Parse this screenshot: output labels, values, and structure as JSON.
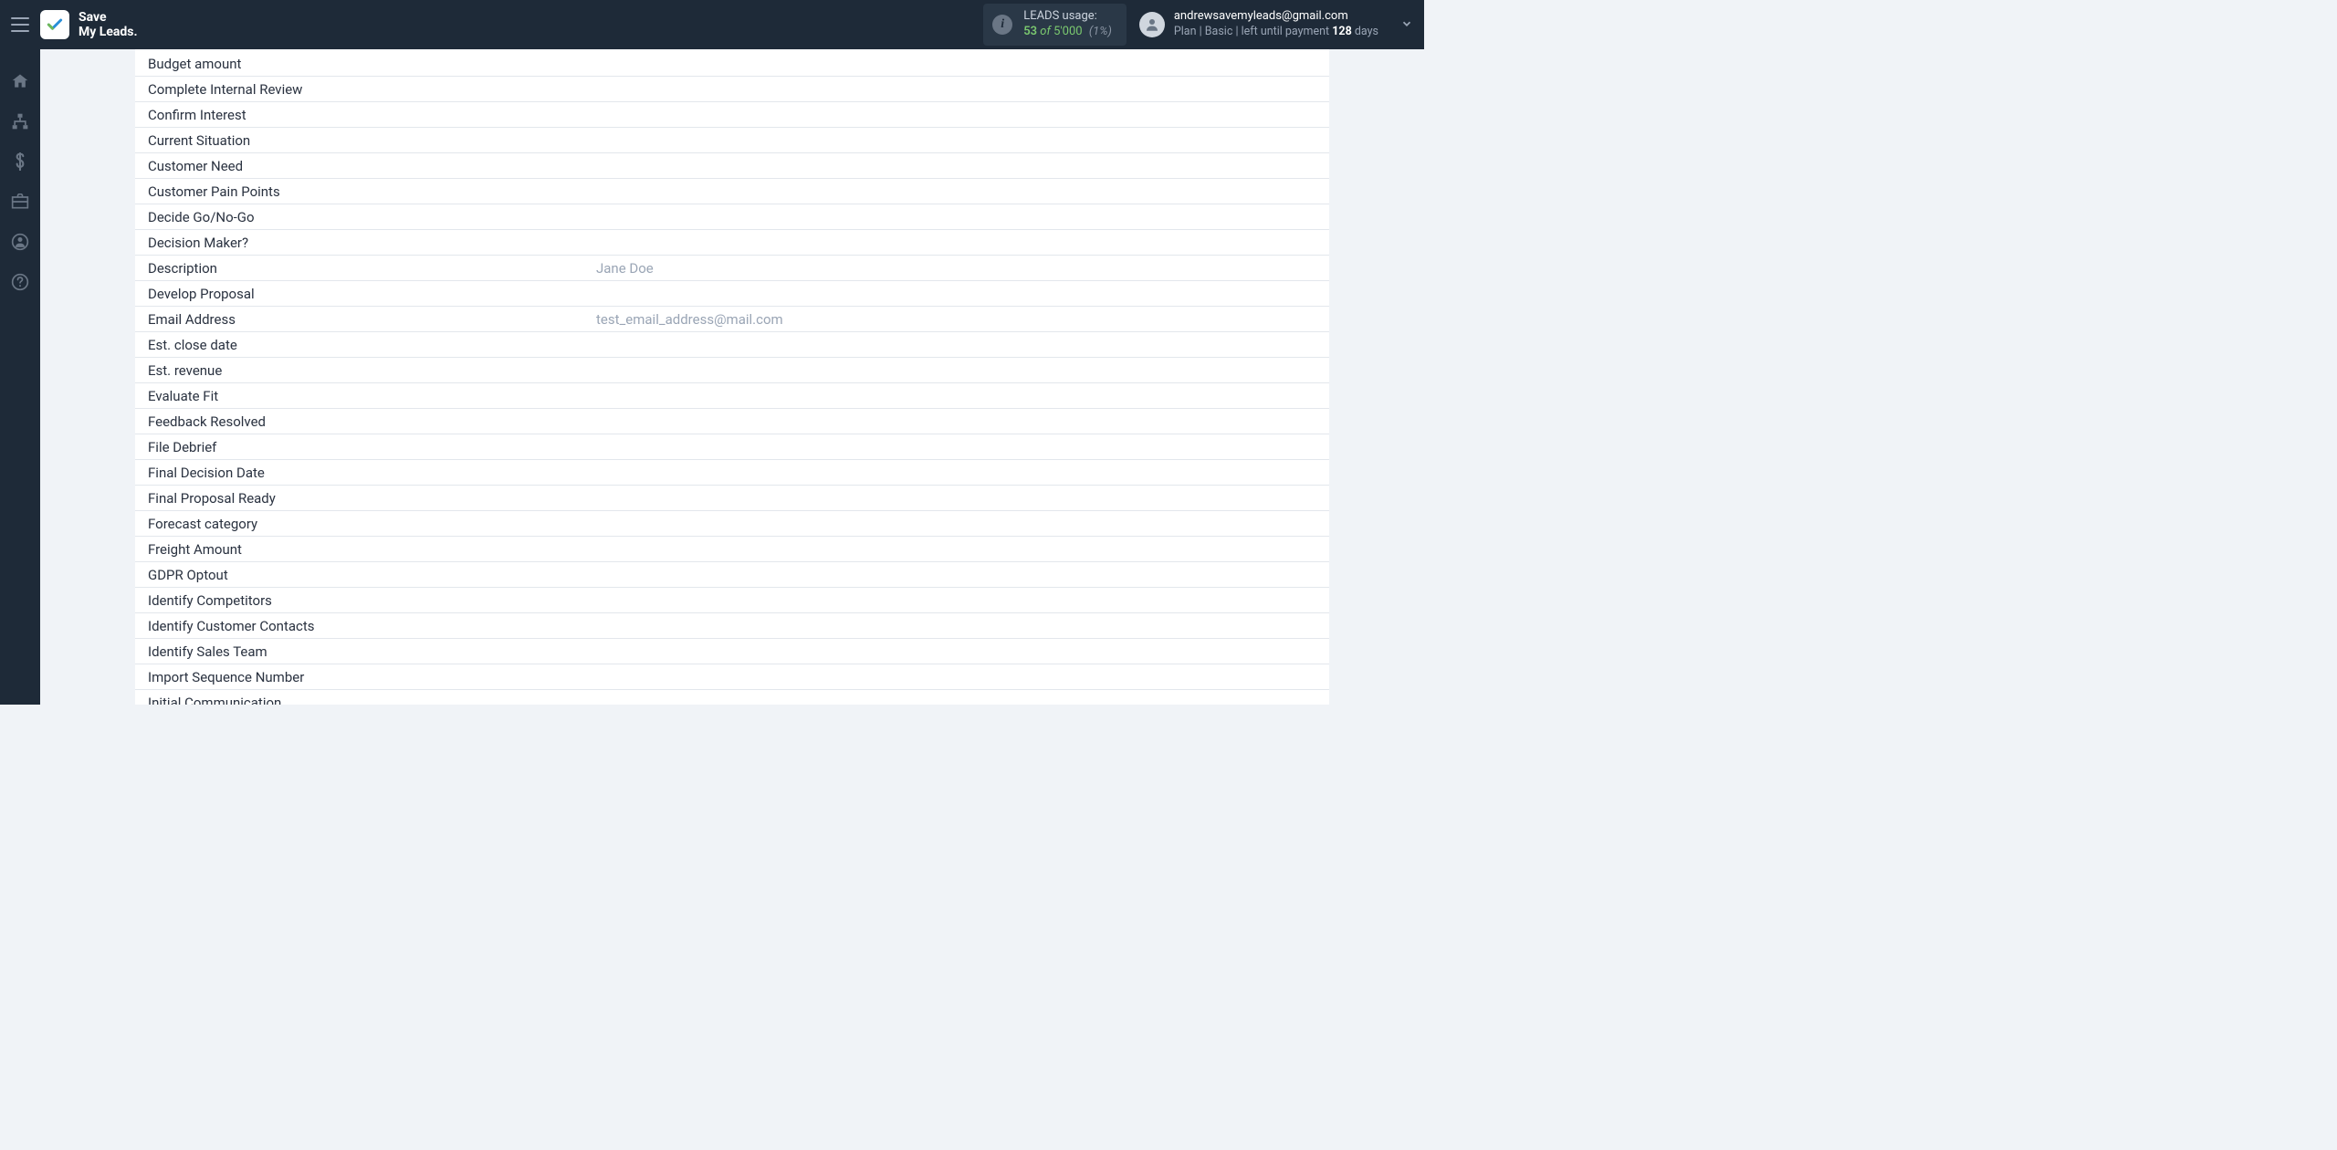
{
  "header": {
    "brand_line1": "Save",
    "brand_line2": "My Leads.",
    "usage": {
      "title": "LEADS usage:",
      "used": "53",
      "of_word": "of",
      "total": "5'000",
      "percent": "(1%)"
    },
    "user": {
      "email": "andrewsavemyleads@gmail.com",
      "plan_prefix": "Plan |",
      "plan_name": "Basic",
      "plan_mid": "| left until payment",
      "days_num": "128",
      "days_word": "days"
    }
  },
  "fields": [
    {
      "label": "Budget amount",
      "value": ""
    },
    {
      "label": "Complete Internal Review",
      "value": ""
    },
    {
      "label": "Confirm Interest",
      "value": ""
    },
    {
      "label": "Current Situation",
      "value": ""
    },
    {
      "label": "Customer Need",
      "value": ""
    },
    {
      "label": "Customer Pain Points",
      "value": ""
    },
    {
      "label": "Decide Go/No-Go",
      "value": ""
    },
    {
      "label": "Decision Maker?",
      "value": ""
    },
    {
      "label": "Description",
      "value": "Jane Doe"
    },
    {
      "label": "Develop Proposal",
      "value": ""
    },
    {
      "label": "Email Address",
      "value": "test_email_address@mail.com"
    },
    {
      "label": "Est. close date",
      "value": ""
    },
    {
      "label": "Est. revenue",
      "value": ""
    },
    {
      "label": "Evaluate Fit",
      "value": ""
    },
    {
      "label": "Feedback Resolved",
      "value": ""
    },
    {
      "label": "File Debrief",
      "value": ""
    },
    {
      "label": "Final Decision Date",
      "value": ""
    },
    {
      "label": "Final Proposal Ready",
      "value": ""
    },
    {
      "label": "Forecast category",
      "value": ""
    },
    {
      "label": "Freight Amount",
      "value": ""
    },
    {
      "label": "GDPR Optout",
      "value": ""
    },
    {
      "label": "Identify Competitors",
      "value": ""
    },
    {
      "label": "Identify Customer Contacts",
      "value": ""
    },
    {
      "label": "Identify Sales Team",
      "value": ""
    },
    {
      "label": "Import Sequence Number",
      "value": ""
    },
    {
      "label": "Initial Communication",
      "value": ""
    }
  ]
}
